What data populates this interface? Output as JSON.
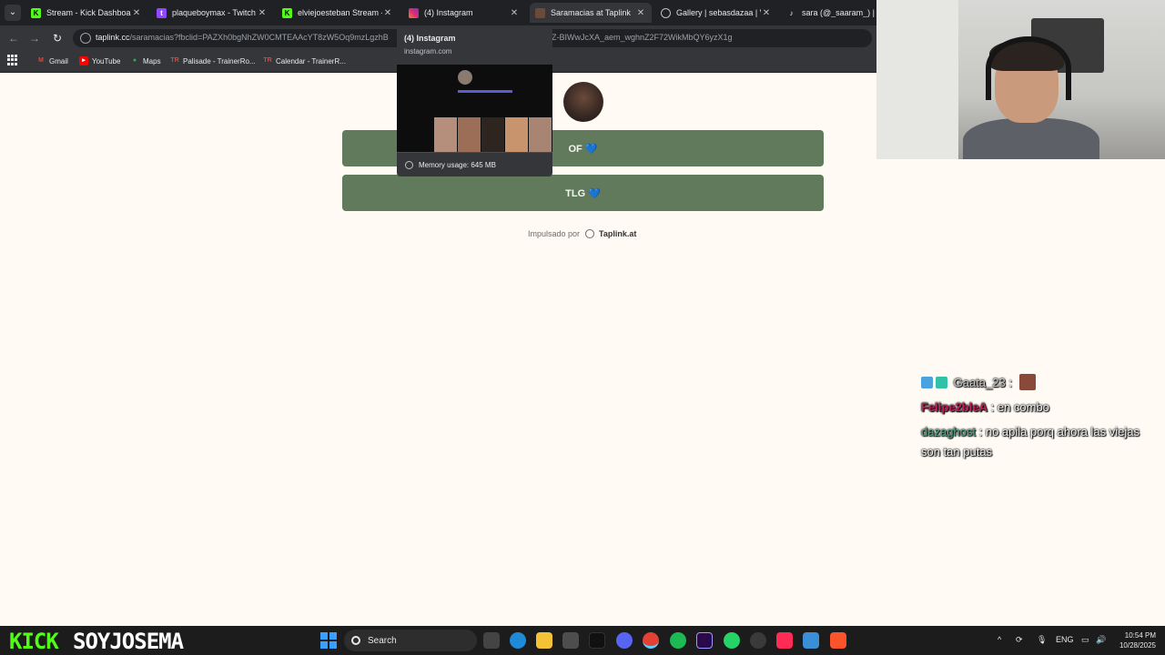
{
  "browser": {
    "tabs": [
      {
        "label": "Stream - Kick Dashboard",
        "favicon": "kick-icon",
        "active": false
      },
      {
        "label": "plaqueboymax - Twitch",
        "favicon": "twitch-icon",
        "active": false
      },
      {
        "label": "elviejoesteban Stream - W",
        "favicon": "kick-icon",
        "active": false
      },
      {
        "label": "(4) Instagram",
        "favicon": "instagram-icon",
        "active": false
      },
      {
        "label": "Saramacias at Taplink",
        "favicon": "taplink-icon",
        "active": true
      },
      {
        "label": "Gallery | sebasdazaa | VSC",
        "favicon": "vsco-icon",
        "active": false
      },
      {
        "label": "sara (@_saaram_) | TikT",
        "favicon": "tiktok-icon",
        "active": false
      }
    ],
    "url_host": "taplink.cc",
    "url_rest": "/saramacias?fbclid=PAZXh0bgNhZW0CMTEAAcYT8zW5Oq9mzLgzhB",
    "url_tail": "Z-BIWwJcXA_aem_wghnZ2F72WikMbQY6yzX1g",
    "bookmarks": [
      "Gmail",
      "YouTube",
      "Maps",
      "Palisade - TrainerRo...",
      "Calendar - TrainerR..."
    ],
    "hovercard": {
      "title": "(4) Instagram",
      "domain": "instagram.com",
      "memory": "Memory usage: 645 MB"
    }
  },
  "page": {
    "buttons": [
      {
        "label": "OF 💙"
      },
      {
        "label": "TLG 💙"
      }
    ],
    "powered_by": "Impulsado por",
    "brand": "Taplink.at"
  },
  "chat": [
    {
      "user": "Gaata_23",
      "user_color": "#c9c9c9",
      "message": ":"
    },
    {
      "user": "Felipe2bleA",
      "user_color": "#c2205a",
      "message": ": en combo"
    },
    {
      "user": "dazaghost",
      "user_color": "#5aa88a",
      "message": ": no apila porq ahora las viejas son tan putas"
    }
  ],
  "overlay": {
    "kick": "KICK",
    "streamer": "SOYJOSEMA"
  },
  "taskbar": {
    "search": "Search",
    "lang": "ENG",
    "time": "10:54 PM",
    "date": "10/28/2025"
  },
  "colors": {
    "button_bg": "#617a5c",
    "page_bg": "#fffbf4",
    "kick_green": "#53fc18"
  }
}
